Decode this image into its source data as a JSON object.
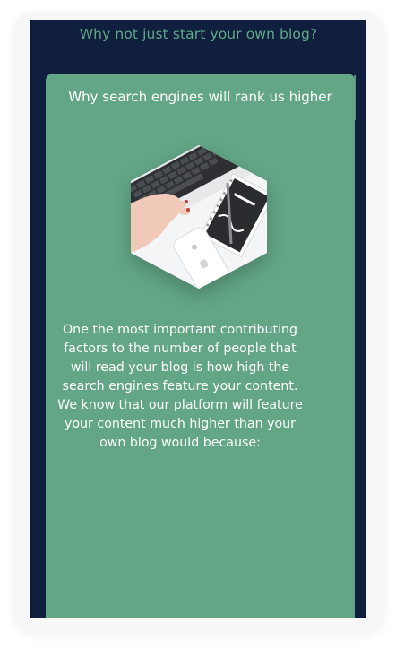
{
  "page": {
    "top_heading": "Why not just start your own blog?"
  },
  "card": {
    "title": "Why search engines will rank us higher",
    "image_icon": "laptop-phone-notebook-photo",
    "body": "One the most important contributing factors to the number of people that will read your blog is how high the search engines feature your content. We know that our platform will feature your content much higher than your own blog would because:"
  },
  "colors": {
    "background": "#101f3d",
    "card": "#62a686",
    "accent_text": "#60a889",
    "text": "#ffffff"
  }
}
